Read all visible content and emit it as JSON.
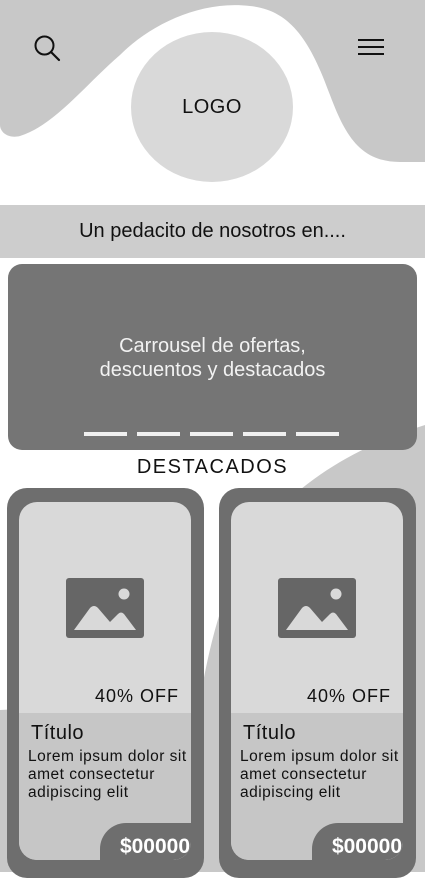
{
  "header": {
    "search_icon": "search-icon",
    "menu_icon": "hamburger-menu-icon",
    "logo_text": "LOGO"
  },
  "tagline": "Un pedacito de nosotros en....",
  "carousel": {
    "line1": "Carrousel de ofertas,",
    "line2": "descuentos y destacados",
    "slide_count": 5
  },
  "section_title": "DESTACADOS",
  "products": [
    {
      "discount": "40% OFF",
      "title": "Título",
      "description": "Lorem ipsum dolor sit amet consectetur adipiscing elit",
      "price": "$00000",
      "image_icon": "image-placeholder-icon"
    },
    {
      "discount": "40% OFF",
      "title": "Título",
      "description": "Lorem ipsum dolor sit amet consectetur adipiscing elit",
      "price": "$00000",
      "image_icon": "image-placeholder-icon"
    }
  ],
  "colors": {
    "background": "#ffffff",
    "wave": "#c8c8c8",
    "carousel": "#757575",
    "card": "#6e6e6e"
  }
}
